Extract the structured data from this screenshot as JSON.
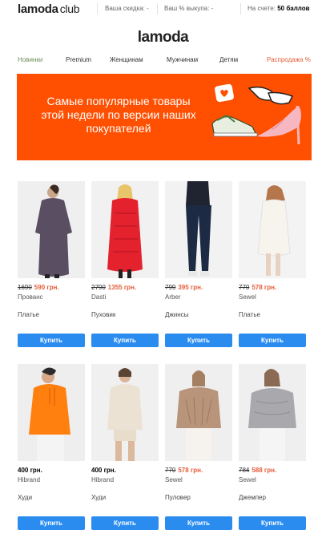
{
  "header": {
    "logo": "lamoda",
    "club": "club",
    "discount_label": "Ваша скидка: -",
    "buyout_label": "Ваш % выкупа: -",
    "account_label": "На счете:",
    "account_value": "50 баллов"
  },
  "brand_logo": "lamoda",
  "nav": {
    "items": [
      "Новинки",
      "Premium",
      "Женщинам",
      "Мужчинам",
      "Детям",
      "Распродажа %"
    ]
  },
  "banner": {
    "text": "Самые популярные товары этой недели по версии наших покупателей",
    "accent": "#ff4f00"
  },
  "colors": {
    "sale_price": "#e35d3a",
    "buy_button": "#2b8cf0",
    "new_nav": "#6f8f5a"
  },
  "products": [
    {
      "old_price": "1690",
      "price": "590 грн.",
      "brand": "Прованс",
      "category": "Платье",
      "button": "Купить"
    },
    {
      "old_price": "2790",
      "price": "1355 грн.",
      "brand": "Dasti",
      "category": "Пуховик",
      "button": "Купить"
    },
    {
      "old_price": "799",
      "price": "395 грн.",
      "brand": "Arber",
      "category": "Джинсы",
      "button": "Купить"
    },
    {
      "old_price": "770",
      "price": "578 грн.",
      "brand": "Sewel",
      "category": "Платье",
      "button": "Купить"
    },
    {
      "old_price": "",
      "price": "400 грн.",
      "brand": "Hibrand",
      "category": "Худи",
      "button": "Купить"
    },
    {
      "old_price": "",
      "price": "400 грн.",
      "brand": "Hibrand",
      "category": "Худи",
      "button": "Купить"
    },
    {
      "old_price": "770",
      "price": "578 грн.",
      "brand": "Sewel",
      "category": "Пуловер",
      "button": "Купить"
    },
    {
      "old_price": "784",
      "price": "588 грн.",
      "brand": "Sewel",
      "category": "Джемпер",
      "button": "Купить"
    }
  ]
}
